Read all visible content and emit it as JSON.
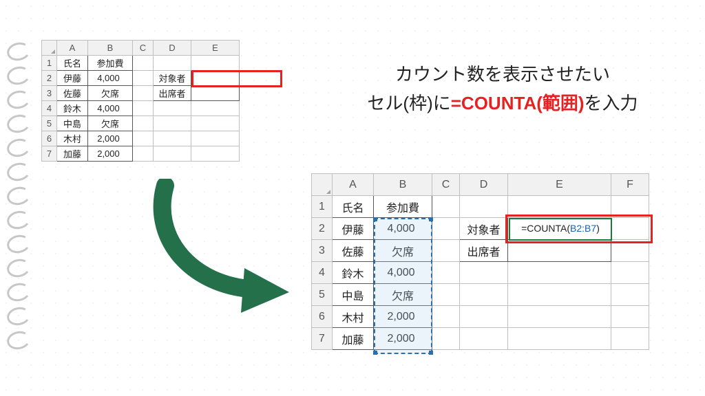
{
  "instruction": {
    "line1": "カウント数を表示させたい",
    "line2_a": "セル(枠)に",
    "line2_b": "=COUNTA(範囲)",
    "line2_c": "を入力"
  },
  "columns_small": [
    "A",
    "B",
    "C",
    "D",
    "E"
  ],
  "columns_big": [
    "A",
    "B",
    "C",
    "D",
    "E",
    "F"
  ],
  "rows": [
    "1",
    "2",
    "3",
    "4",
    "5",
    "6",
    "7"
  ],
  "data": {
    "headers": {
      "name": "氏名",
      "fee": "参加費",
      "target": "対象者",
      "attendee": "出席者"
    },
    "people": [
      {
        "name": "伊藤",
        "fee": "4,000"
      },
      {
        "name": "佐藤",
        "fee": "欠席"
      },
      {
        "name": "鈴木",
        "fee": "4,000"
      },
      {
        "name": "中島",
        "fee": "欠席"
      },
      {
        "name": "木村",
        "fee": "2,000"
      },
      {
        "name": "加藤",
        "fee": "2,000"
      }
    ]
  },
  "formula": {
    "prefix": "=COUNTA(",
    "ref": "B2:B7",
    "suffix": ")"
  }
}
